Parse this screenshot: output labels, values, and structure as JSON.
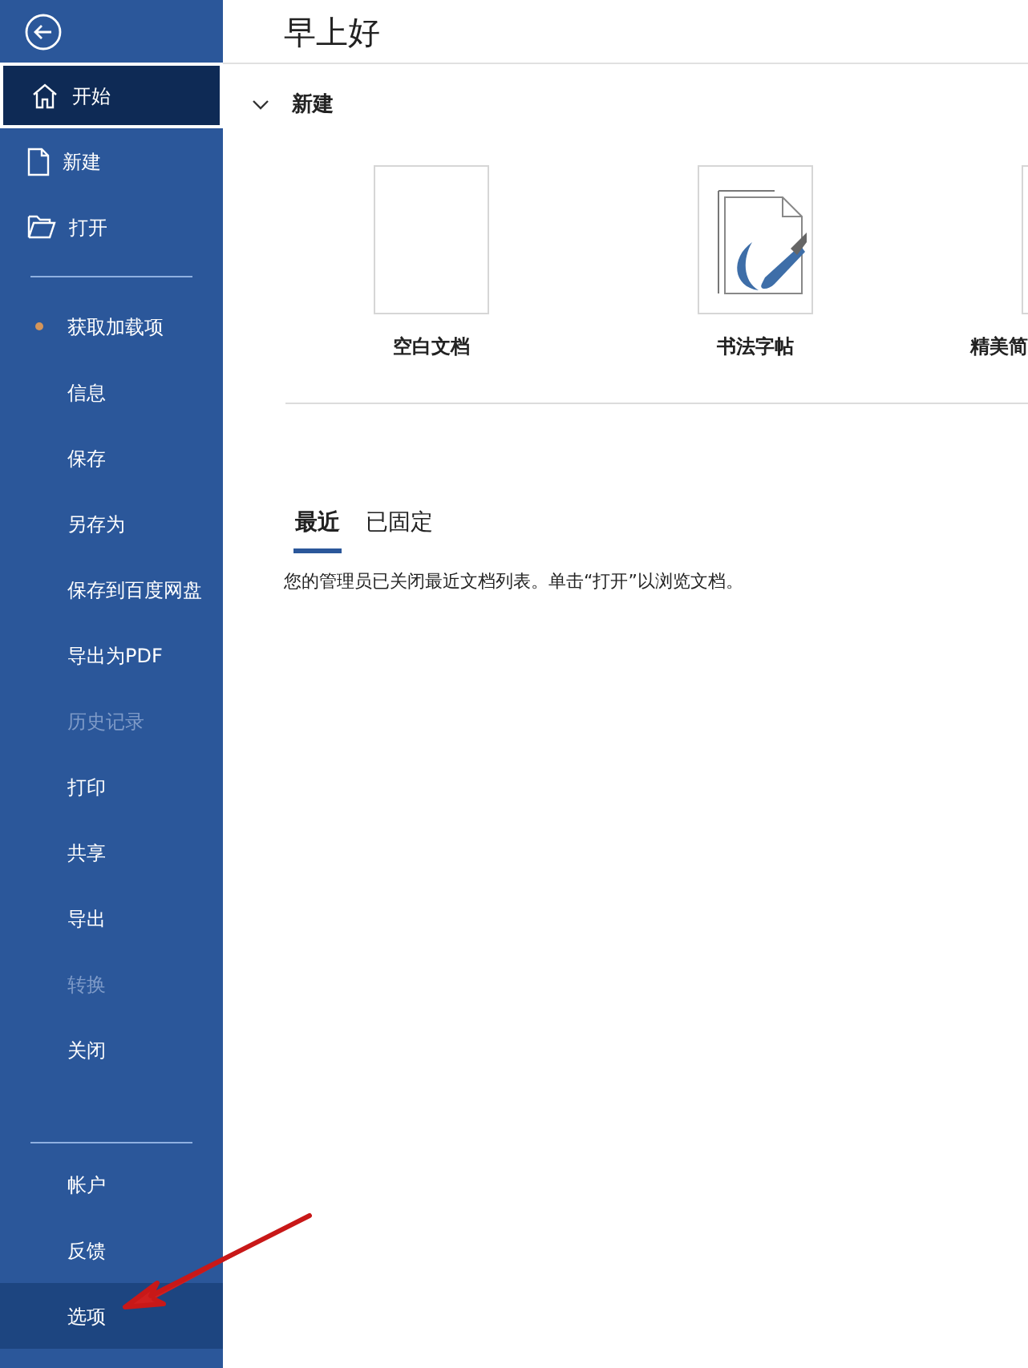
{
  "sidebar": {
    "top_items": [
      {
        "label": "开始",
        "kind": "home",
        "selected": true,
        "disabled": false,
        "highlighted": false
      },
      {
        "label": "新建",
        "kind": "document",
        "selected": false,
        "disabled": false,
        "highlighted": false
      },
      {
        "label": "打开",
        "kind": "folder",
        "selected": false,
        "disabled": false,
        "highlighted": false
      }
    ],
    "items": [
      {
        "label": "获取加载项",
        "kind": "dot",
        "color": "#d4955a",
        "selected": false,
        "disabled": false,
        "highlighted": false
      },
      {
        "label": "信息",
        "kind": "plain",
        "selected": false,
        "disabled": false,
        "highlighted": false
      },
      {
        "label": "保存",
        "kind": "plain",
        "selected": false,
        "disabled": false,
        "highlighted": false
      },
      {
        "label": "另存为",
        "kind": "plain",
        "selected": false,
        "disabled": false,
        "highlighted": false
      },
      {
        "label": "保存到百度网盘",
        "kind": "plain",
        "selected": false,
        "disabled": false,
        "highlighted": false
      },
      {
        "label": "导出为PDF",
        "kind": "plain",
        "selected": false,
        "disabled": false,
        "highlighted": false
      },
      {
        "label": "历史记录",
        "kind": "plain",
        "selected": false,
        "disabled": true,
        "highlighted": false
      },
      {
        "label": "打印",
        "kind": "plain",
        "selected": false,
        "disabled": false,
        "highlighted": false
      },
      {
        "label": "共享",
        "kind": "plain",
        "selected": false,
        "disabled": false,
        "highlighted": false
      },
      {
        "label": "导出",
        "kind": "plain",
        "selected": false,
        "disabled": false,
        "highlighted": false
      },
      {
        "label": "转换",
        "kind": "plain",
        "selected": false,
        "disabled": true,
        "highlighted": false
      },
      {
        "label": "关闭",
        "kind": "plain",
        "selected": false,
        "disabled": false,
        "highlighted": false
      }
    ],
    "bottom_items": [
      {
        "label": "帐户",
        "kind": "plain",
        "selected": false,
        "disabled": false,
        "highlighted": false
      },
      {
        "label": "反馈",
        "kind": "plain",
        "selected": false,
        "disabled": false,
        "highlighted": false
      },
      {
        "label": "选项",
        "kind": "plain",
        "selected": false,
        "disabled": false,
        "highlighted": true
      }
    ]
  },
  "main": {
    "title": "早上好",
    "new_section": {
      "title": "新建",
      "expanded": true,
      "templates": [
        {
          "label": "空白文档",
          "kind": "blank"
        },
        {
          "label": "书法字帖",
          "kind": "calligraphy"
        },
        {
          "label": "精美简",
          "kind": "partial"
        }
      ]
    },
    "tabs": [
      {
        "label": "最近",
        "selected": true
      },
      {
        "label": "已固定",
        "selected": false
      }
    ],
    "message": "您的管理员已关闭最近文档列表。单击“打开”以浏览文档。"
  }
}
